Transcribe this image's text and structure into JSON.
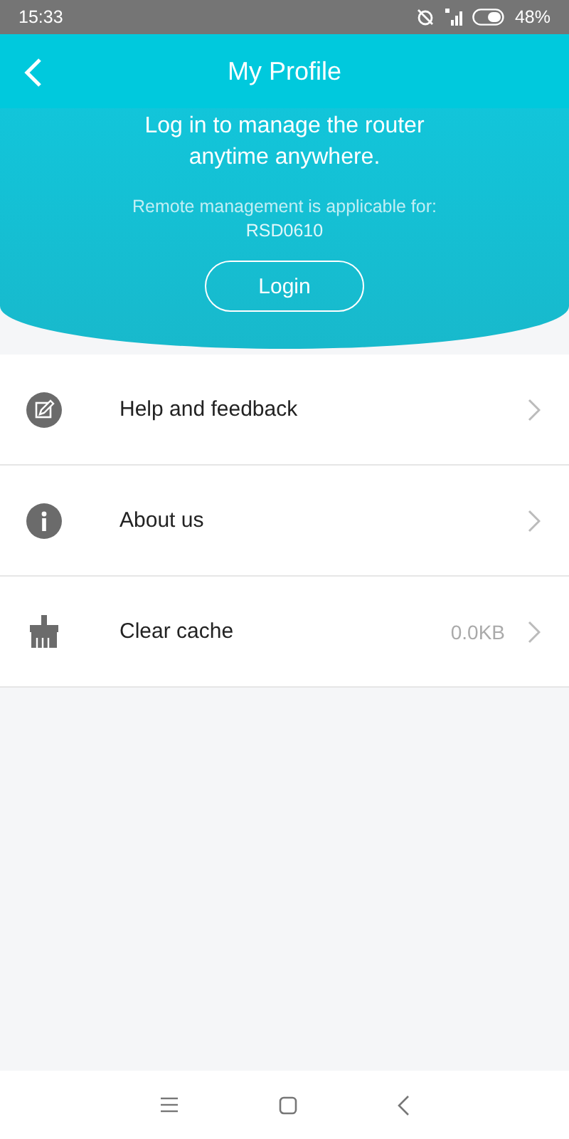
{
  "status_bar": {
    "time": "15:33",
    "battery": "48%"
  },
  "header": {
    "title": "My Profile"
  },
  "login_panel": {
    "message": "Log in to manage the router anytime anywhere.",
    "note": "Remote management is applicable for:",
    "model": "RSD0610",
    "button": "Login"
  },
  "menu": [
    {
      "label": "Help and feedback"
    },
    {
      "label": "About us"
    },
    {
      "label": "Clear cache",
      "value": "0.0KB"
    }
  ]
}
